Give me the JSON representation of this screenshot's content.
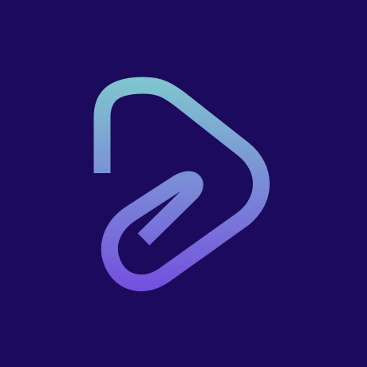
{
  "icon": {
    "name": "paperclip-play-logo-icon",
    "colors": {
      "background": "#1c0a5c",
      "gradient_top": "#80c6cf",
      "gradient_bottom": "#7450de"
    }
  }
}
